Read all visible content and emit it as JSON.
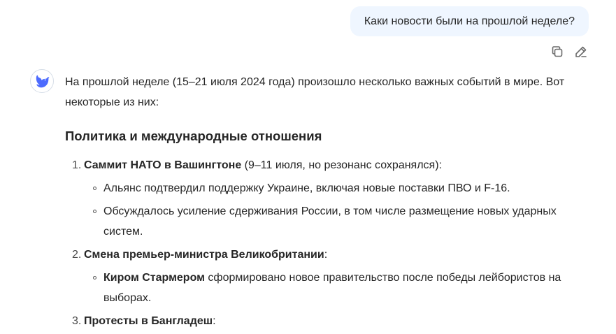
{
  "user_message": {
    "text": "Каки новости были на прошлой неделе?"
  },
  "message_actions": {
    "copy_icon": "copy-icon",
    "edit_icon": "edit-icon"
  },
  "assistant": {
    "avatar_icon": "whale-logo-icon",
    "intro": "На прошлой неделе (15–21 июля 2024 года) произошло несколько важных событий в мире. Вот некоторые из них:",
    "section_title": "Политика и международные отношения",
    "items": [
      {
        "num": "1.",
        "title": "Саммит НАТО в Вашингтоне",
        "rest": " (9–11 июля, но резонанс сохранялся):",
        "subitems": [
          {
            "bold": "",
            "text": "Альянс подтвердил поддержку Украине, включая новые поставки ПВО и F-16."
          },
          {
            "bold": "",
            "text": "Обсуждалось усиление сдерживания России, в том числе размещение новых ударных систем."
          }
        ]
      },
      {
        "num": "2.",
        "title": "Смена премьер-министра Великобритании",
        "rest": ":",
        "subitems": [
          {
            "bold": "Киром Стармером",
            "text": " сформировано новое правительство после победы лейбористов на выборах."
          }
        ]
      },
      {
        "num": "3.",
        "title": "Протесты в Бангладеш",
        "rest": ":",
        "subitems": []
      }
    ]
  },
  "colors": {
    "user_bubble_bg": "#eff6ff",
    "text": "#262626",
    "icon": "#6b6b6b",
    "brand": "#4d6bfe"
  }
}
